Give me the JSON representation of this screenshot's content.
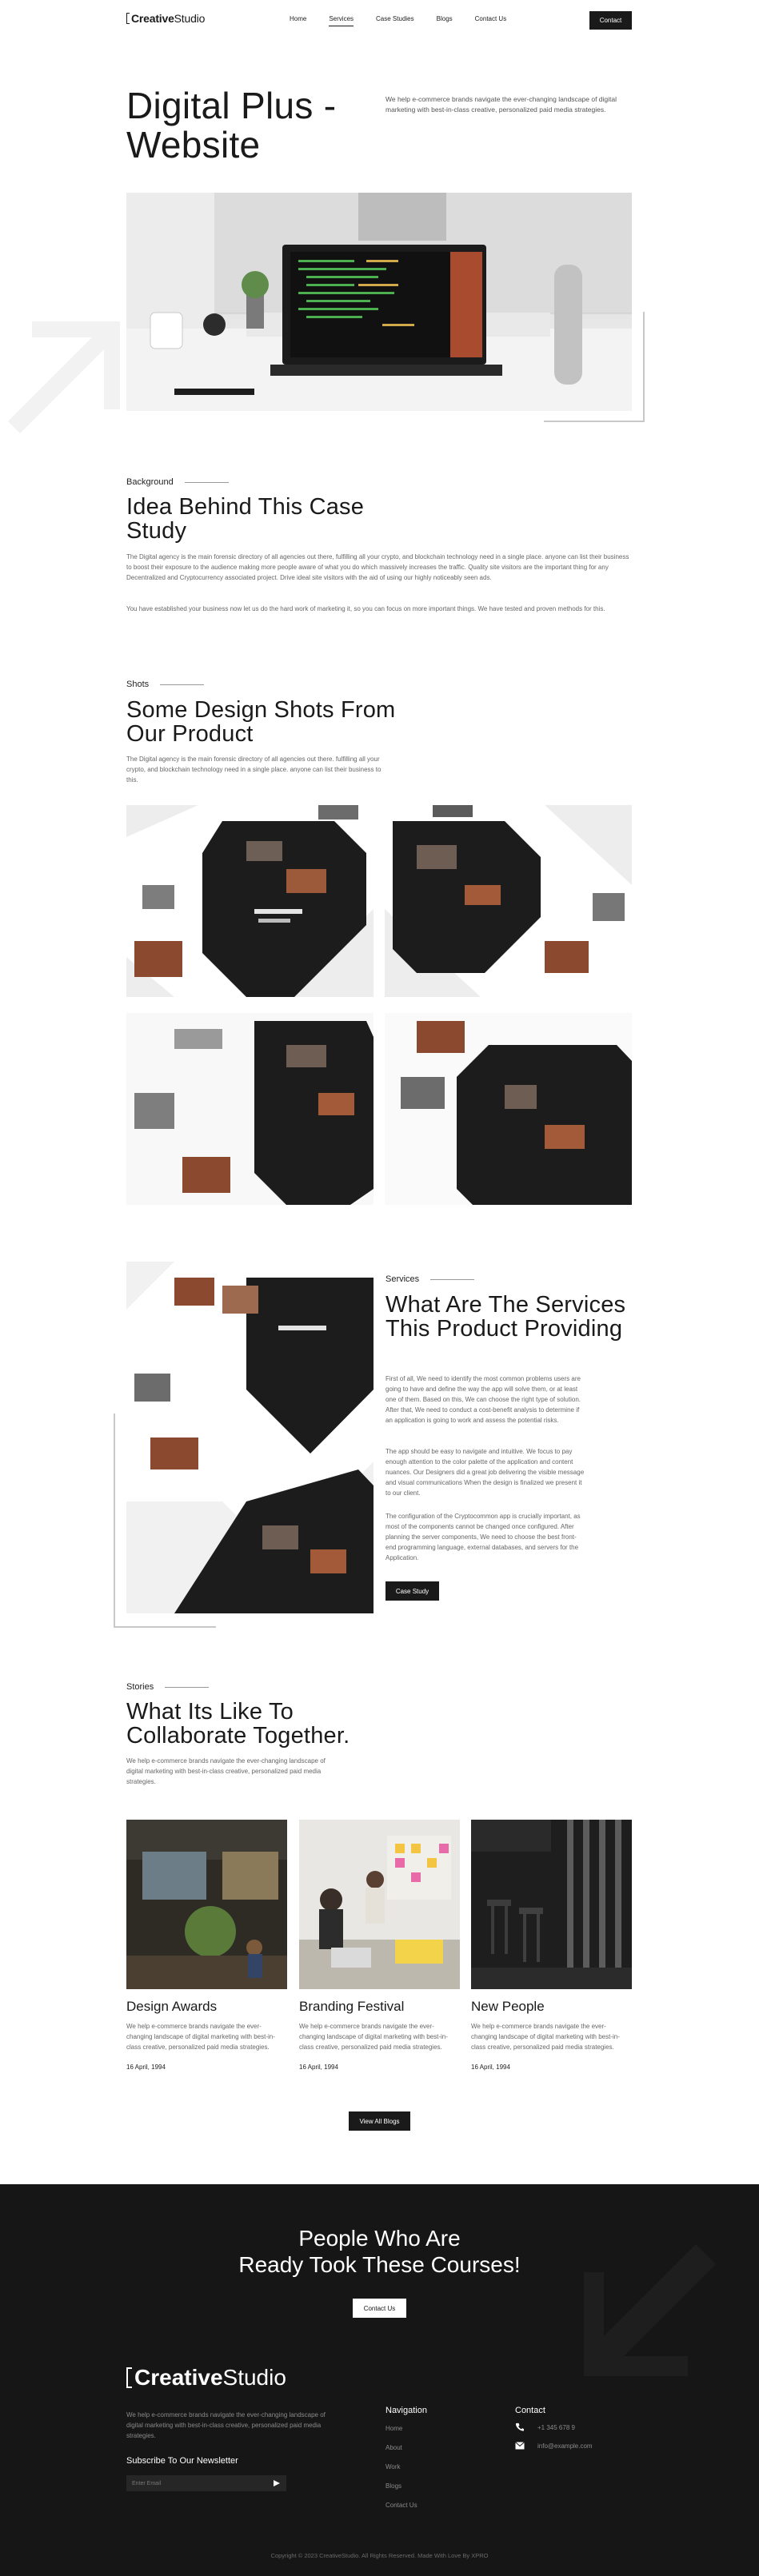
{
  "header": {
    "logo": {
      "bold": "Creative",
      "light": "Studio"
    },
    "nav": [
      "Home",
      "Services",
      "Case Studies",
      "Blogs",
      "Contact Us"
    ],
    "nav_active_index": 1,
    "contact_button": "Contact"
  },
  "hero": {
    "title": "Digital Plus - Website",
    "description": "We help e-commerce brands navigate the ever-changing landscape of digital marketing with best-in-class creative, personalized paid media strategies."
  },
  "background": {
    "eyebrow": "Background",
    "title": "Idea Behind This Case Study",
    "p1": "The Digital agency is the main forensic directory of all agencies out there, fulfilling all your crypto, and blockchain technology need in a single place. anyone can list their business to boost their exposure to the audience making more people aware of what you do which massively increases the traffic. Quality site visitors are the important thing for any Decentralized and Cryptocurrency associated project. Drive ideal site visitors with the aid of using our highly noticeably seen ads.",
    "p2": "You have established your business now let us do the hard work of marketing it, so you can focus on more important things. We have tested and proven methods for this."
  },
  "shots": {
    "eyebrow": "Shots",
    "title": "Some Design Shots From Our Product",
    "description": "The Digital agency is the main forensic directory of all agencies out there. fulfilling all your crypto, and blockchain technology need in a single place. anyone can list their business to this."
  },
  "services": {
    "eyebrow": "Services",
    "title": "What Are The Services This Product Providing",
    "p1": "First of all, We need to identify the most common problems users are going to have and define the way the app will solve them, or at least one of them. Based on this, We can choose the right type of solution. After that, We need to conduct a cost-benefit analysis to determine if an application is going to work and assess the potential risks.",
    "p2": "The app should be easy to navigate and intuitive. We focus to pay enough attention to the color palette of the application and content nuances. Our Designers did a great job delivering the visible message and visual communications When the design is finalized we present it to our client.",
    "p3": "The configuration of the Cryptocommon app is crucially important, as most of the components cannot be changed once configured. After planning the server components, We need to choose the best front-end programming language, external databases, and servers for the Application.",
    "button": "Case Study"
  },
  "stories": {
    "eyebrow": "Stories",
    "title": "What Its Like To Collaborate Together.",
    "description": "We help e-commerce brands navigate the ever-changing landscape of digital marketing with best-in-class creative, personalized paid media strategies.",
    "cards": [
      {
        "title": "Design Awards",
        "text": "We help e-commerce brands navigate the ever-changing landscape of digital marketing with best-in-class creative, personalized paid media strategies.",
        "date": "16 April, 1994"
      },
      {
        "title": "Branding Festival",
        "text": "We help e-commerce brands navigate the ever-changing landscape of digital marketing with best-in-class creative, personalized paid media strategies.",
        "date": "16 April, 1994"
      },
      {
        "title": "New People",
        "text": "We help e-commerce brands navigate the ever-changing landscape of digital marketing with best-in-class creative, personalized paid media strategies.",
        "date": "16 April, 1994"
      }
    ],
    "view_all": "View All Blogs"
  },
  "footer": {
    "cta_line1": "People Who Are",
    "cta_line2": "Ready Took These Courses!",
    "cta_button": "Contact Us",
    "logo": {
      "bold": "Creative",
      "light": "Studio"
    },
    "description": "We help e-commerce brands navigate the ever-changing landscape of digital marketing with best-in-class creative, personalized paid media strategies.",
    "subscribe_title": "Subscribe To Our Newsletter",
    "email_placeholder": "Enter Email",
    "nav_title": "Navigation",
    "nav_links": [
      "Home",
      "About",
      "Work",
      "Blogs",
      "Contact Us"
    ],
    "contact_title": "Contact",
    "phone": "+1 345 678 9",
    "email": "info@example.com",
    "copyright": "Copyright © 2023 CreativeStudio. All Rights Reserved. Made With Love By XPRO"
  },
  "colors": {
    "dark": "#161616",
    "text": "#1a1a1a",
    "muted": "#666666"
  }
}
